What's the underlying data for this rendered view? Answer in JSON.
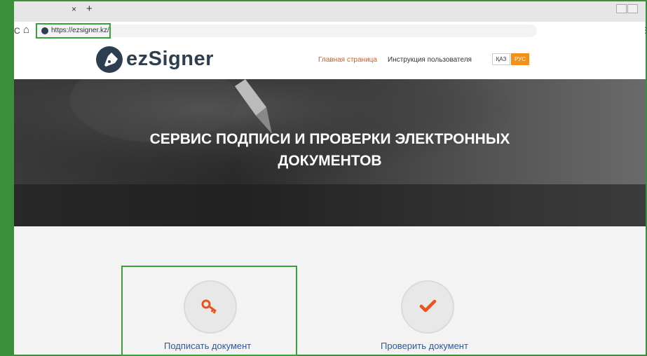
{
  "browser": {
    "tab_close": "×",
    "tab_new": "+",
    "url": "https://ezsigner.kz/",
    "reload": "C",
    "home": "⌂",
    "menu": "⋮"
  },
  "site": {
    "logo_text": "ezSigner",
    "nav": [
      "Главная страница",
      "Инструкция пользователя"
    ],
    "lang": [
      "ҚАЗ",
      "РУС"
    ],
    "accent": "#e8541e",
    "lang_active": "#f39019"
  },
  "hero": {
    "line1": "СЕРВИС ПОДПИСИ И ПРОВЕРКИ ЭЛЕКТРОННЫХ",
    "line2": "ДОКУМЕНТОВ"
  },
  "cards": [
    {
      "label": "Подписать документ",
      "icon": "key-icon"
    },
    {
      "label": "Проверить документ",
      "icon": "check-icon"
    }
  ]
}
